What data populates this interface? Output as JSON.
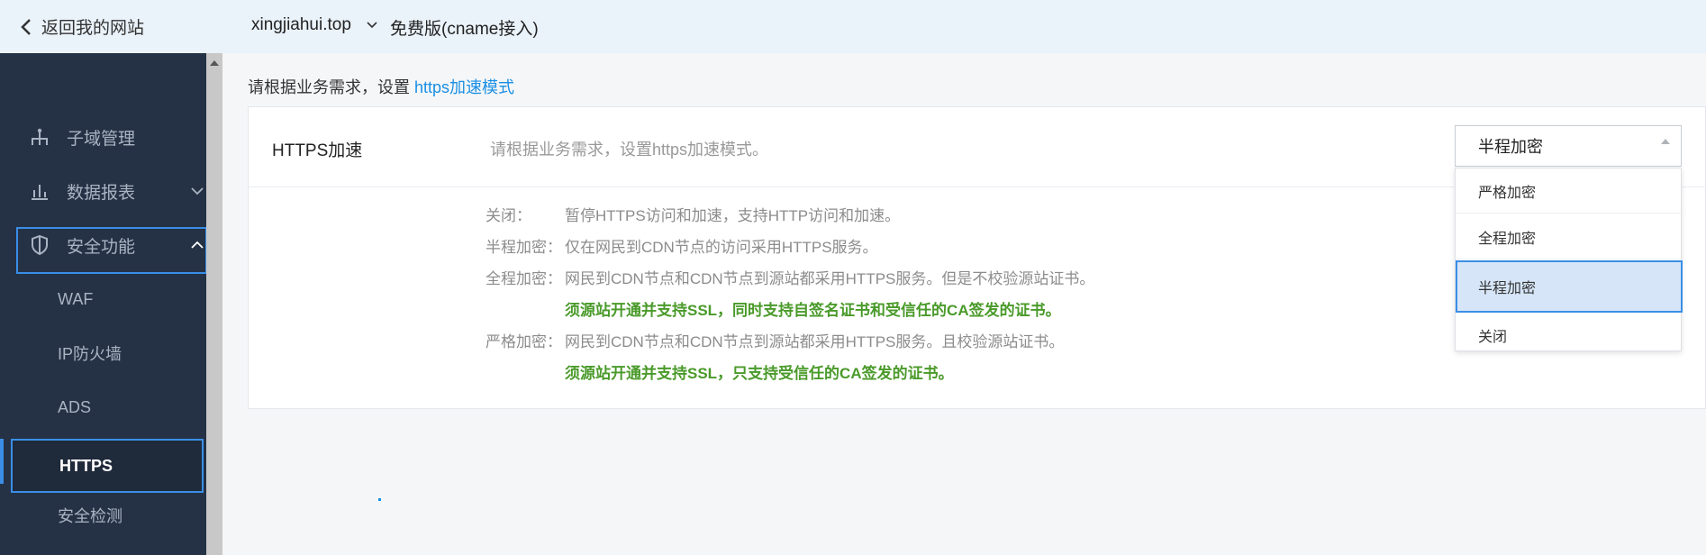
{
  "topbar": {
    "back_label": "返回我的网站",
    "domain": "xingjiahui.top",
    "plan": "免费版(cname接入)"
  },
  "sidebar": {
    "items": [
      {
        "label": "子域管理",
        "icon": "sitemap-icon"
      },
      {
        "label": "数据报表",
        "icon": "bar-chart-icon"
      },
      {
        "label": "安全功能",
        "icon": "shield-icon"
      }
    ],
    "sub_items": [
      {
        "label": "WAF"
      },
      {
        "label": "IP防火墙"
      },
      {
        "label": "ADS"
      },
      {
        "label": "HTTPS"
      },
      {
        "label": "安全检测"
      }
    ]
  },
  "main": {
    "intro_prefix": "请根据业务需求，设置 ",
    "intro_link": "https加速模式",
    "https_label": "HTTPS加速",
    "https_desc": "请根据业务需求，设置https加速模式。",
    "notes": [
      {
        "key": "关闭：",
        "text": "暂停HTTPS访问和加速，支持HTTP访问和加速。"
      },
      {
        "key": "半程加密：",
        "text": "仅在网民到CDN节点的访问采用HTTPS服务。"
      },
      {
        "key": "全程加密：",
        "text": "网民到CDN节点和CDN节点到源站都采用HTTPS服务。但是不校验源站证书。"
      },
      {
        "green": "须源站开通并支持SSL，同时支持自签名证书和受信任的CA签发的证书。"
      },
      {
        "key": "严格加密：",
        "text": "网民到CDN节点和CDN节点到源站都采用HTTPS服务。且校验源站证书。"
      },
      {
        "green": "须源站开通并支持SSL，只支持受信任的CA签发的证书。"
      }
    ]
  },
  "select": {
    "value": "半程加密",
    "options": [
      "严格加密",
      "全程加密",
      "半程加密",
      "关闭"
    ]
  },
  "colors": {
    "accent": "#3a8ee6",
    "sidebar_bg": "#253246",
    "green": "#4a9a2a"
  }
}
